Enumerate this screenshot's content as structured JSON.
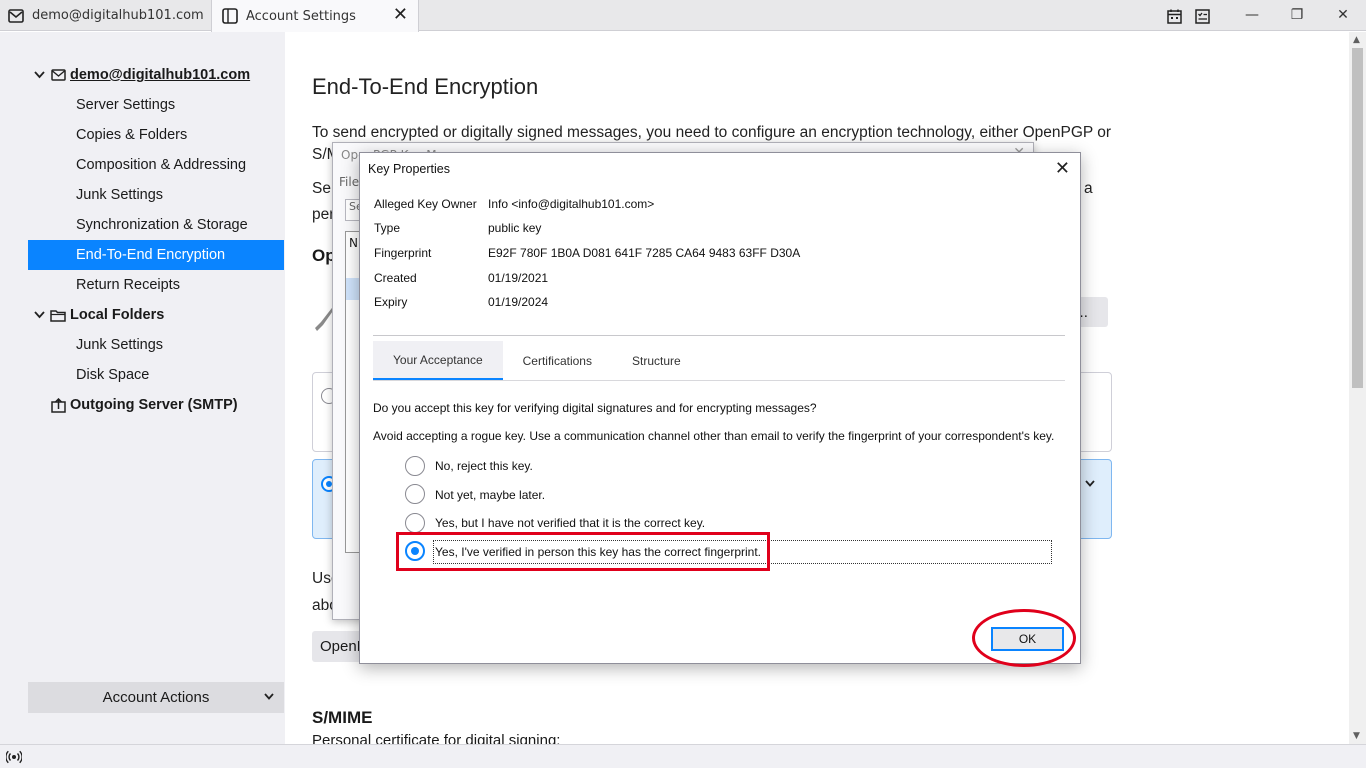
{
  "tabs": [
    {
      "label": "demo@digitalhub101.com",
      "icon": "mail-icon"
    },
    {
      "label": "Account Settings",
      "icon": "settings-tab-icon",
      "close": "✕"
    }
  ],
  "window": {
    "minimize": "—",
    "restore": "❐",
    "close": "✕"
  },
  "sidebar": {
    "accounts": [
      {
        "label": "demo@digitalhub101.com",
        "icon": "mail-icon"
      },
      {
        "label": "Local Folders",
        "icon": "folder-icon"
      },
      {
        "label": "Outgoing Server (SMTP)",
        "icon": "outgoing-server-icon"
      }
    ],
    "items": [
      "Server Settings",
      "Copies & Folders",
      "Composition & Addressing",
      "Junk Settings",
      "Synchronization & Storage",
      "End-To-End Encryption",
      "Return Receipts"
    ],
    "local_items": [
      "Junk Settings",
      "Disk Space"
    ],
    "selected": "End-To-End Encryption",
    "account_actions": "Account Actions"
  },
  "main": {
    "title": "End-To-End Encryption",
    "intro": "To send encrypted or digitally signed messages, you need to configure an encryption technology, either OpenPGP or",
    "frag_sm": "S/M",
    "frag_sel": "Sel",
    "frag_per": "per",
    "frag_a": "a",
    "frag_op": "Op",
    "frag_y": "y...",
    "frag_use": "Use",
    "frag_abo": "abo",
    "frag_openp": "OpenP",
    "smime_heading": "S/MIME",
    "smime_sub": "Personal certificate for digital signing:"
  },
  "key_manager": {
    "title": "OpenPGP Key Manager",
    "menu": "File",
    "search": "Se",
    "list_header": "N"
  },
  "key_properties": {
    "title": "Key Properties",
    "close": "✕",
    "props": [
      {
        "key": "Alleged Key Owner",
        "value": "Info <info@digitalhub101.com>"
      },
      {
        "key": "Type",
        "value": "public key"
      },
      {
        "key": "Fingerprint",
        "value": "E92F 780F 1B0A D081 641F 7285 CA64 9483 63FF D30A"
      },
      {
        "key": "Created",
        "value": "01/19/2021"
      },
      {
        "key": "Expiry",
        "value": "01/19/2024"
      }
    ],
    "tabs": [
      "Your Acceptance",
      "Certifications",
      "Structure"
    ],
    "question": "Do you accept this key for verifying digital signatures and for encrypting messages?",
    "warning": "Avoid accepting a rogue key. Use a communication channel other than email to verify the fingerprint of your correspondent's key.",
    "options": [
      "No, reject this key.",
      "Not yet, maybe later.",
      "Yes, but I have not verified that it is the correct key.",
      "Yes, I've verified in person this key has the correct fingerprint."
    ],
    "selected_option": 3,
    "ok": "OK"
  },
  "colors": {
    "accent": "#0a84ff",
    "annotation": "#e0001b"
  }
}
